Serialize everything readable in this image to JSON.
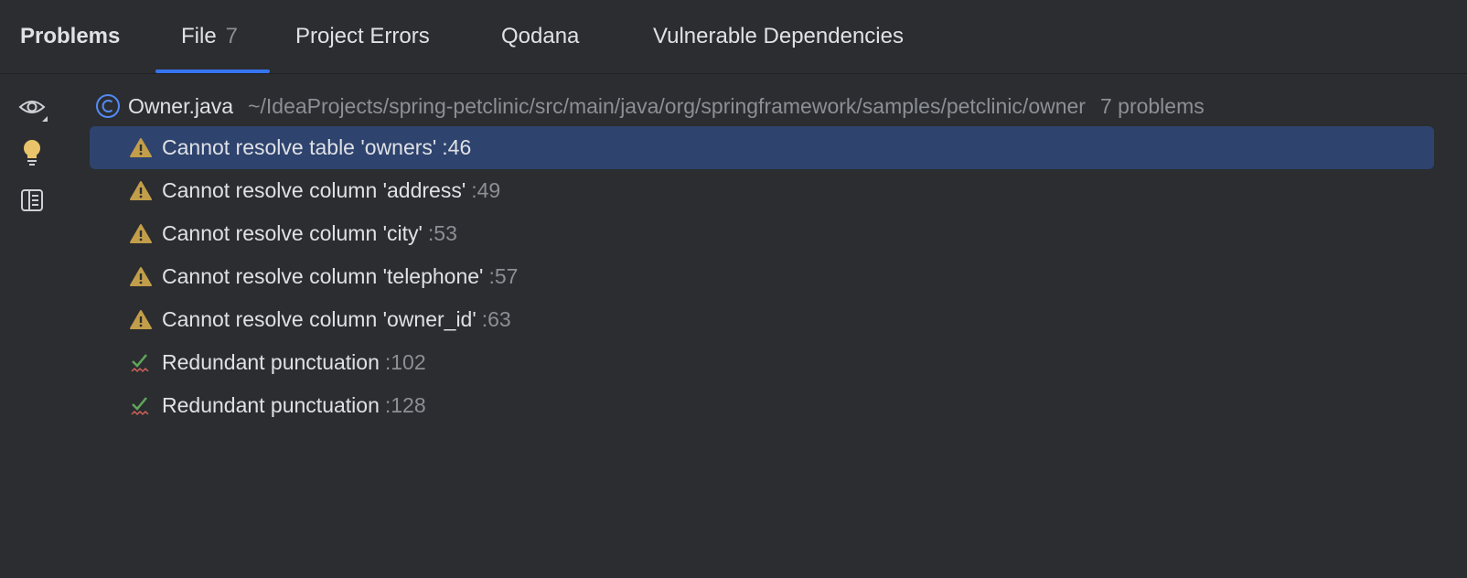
{
  "header": {
    "title": "Problems",
    "tabs": [
      {
        "label": "File",
        "count": "7",
        "active": true
      },
      {
        "label": "Project Errors"
      },
      {
        "label": "Qodana"
      },
      {
        "label": "Vulnerable Dependencies"
      }
    ]
  },
  "sidebar": {
    "icons": [
      "eye-icon",
      "lightbulb-icon",
      "preview-panel-icon"
    ]
  },
  "file": {
    "name": "Owner.java",
    "path": "~/IdeaProjects/spring-petclinic/src/main/java/org/springframework/samples/petclinic/owner",
    "problems": "7 problems"
  },
  "problems": [
    {
      "text": "Cannot resolve table 'owners'",
      "line": ":46",
      "type": "warning",
      "selected": true
    },
    {
      "text": "Cannot resolve column 'address'",
      "line": ":49",
      "type": "warning"
    },
    {
      "text": "Cannot resolve column 'city'",
      "line": ":53",
      "type": "warning"
    },
    {
      "text": "Cannot resolve column 'telephone'",
      "line": ":57",
      "type": "warning"
    },
    {
      "text": "Cannot resolve column 'owner_id'",
      "line": ":63",
      "type": "warning"
    },
    {
      "text": "Redundant punctuation",
      "line": ":102",
      "type": "grammar"
    },
    {
      "text": "Redundant punctuation",
      "line": ":128",
      "type": "grammar"
    }
  ],
  "colors": {
    "accent": "#3574f0",
    "selection": "#2e436e",
    "warning": "#c29e4a",
    "grammar_check": "#5fa65a",
    "grammar_wave": "#d0605a"
  }
}
